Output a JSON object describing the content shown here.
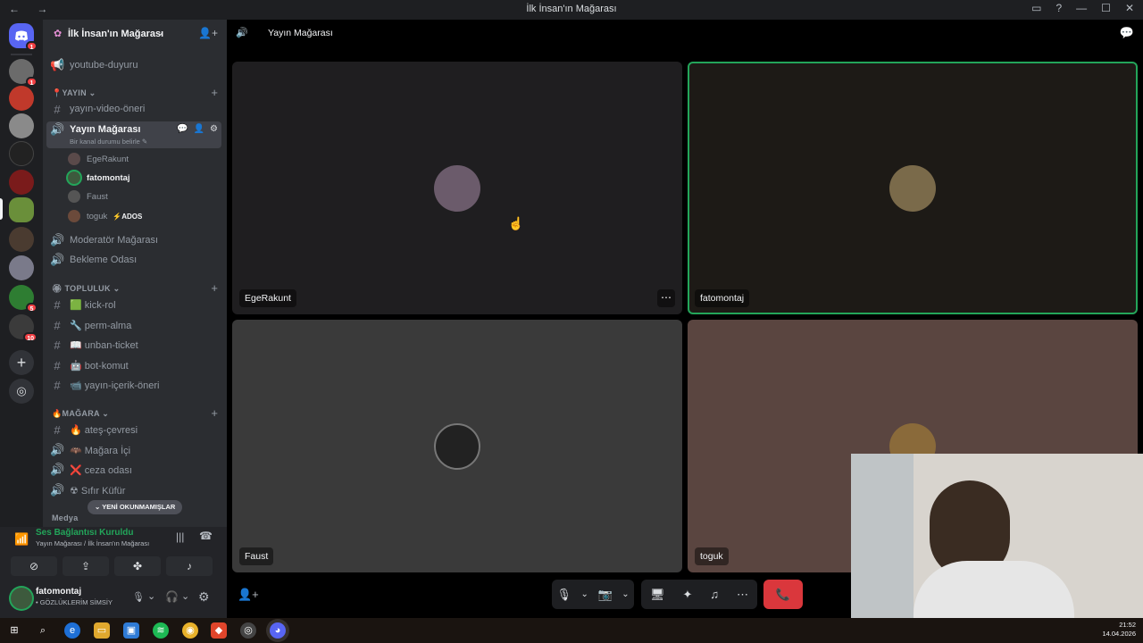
{
  "window": {
    "title": "İlk İnsan'ın Mağarası",
    "nav_arrows": "← →",
    "controls": [
      "▭",
      "?",
      "—",
      "☐",
      "✕"
    ]
  },
  "servers": [
    {
      "name": "direct-messages",
      "badge": "1",
      "color": "#5865f2"
    },
    {
      "name": "server-1",
      "badge": "1",
      "color": "#6b6b6b"
    },
    {
      "name": "server-2",
      "badge": "",
      "color": "#c0392b"
    },
    {
      "name": "server-3",
      "badge": "",
      "color": "#8a8a8a"
    },
    {
      "name": "server-4",
      "badge": "",
      "color": "#222222"
    },
    {
      "name": "server-5",
      "badge": "",
      "color": "#7a1b1b"
    },
    {
      "name": "server-6",
      "badge": "",
      "color": "#6a8f3a"
    },
    {
      "name": "server-7",
      "badge": "",
      "color": "#4a3b30"
    },
    {
      "name": "server-8",
      "badge": "",
      "color": "#7a7a8a"
    },
    {
      "name": "server-9",
      "badge": "5",
      "color": "#2e7d32"
    },
    {
      "name": "server-10",
      "badge": "10",
      "color": "#3b3b3b"
    }
  ],
  "guild": {
    "name": "İlk İnsan'ın Mağarası",
    "chevron": "⌄"
  },
  "channels": {
    "youtube": {
      "icon": "📢",
      "label": "youtube-duyuru"
    },
    "cat_yayin": {
      "label": "YAYIN",
      "prefix": "📍"
    },
    "yayin_video": {
      "label": "yayın-video-öneri"
    },
    "active_voice": {
      "label": "Yayın Mağarası",
      "status": "Bir kanal durumu belirle ✎"
    },
    "voice_users": [
      {
        "name": "EgeRakunt",
        "color": "#5a4a4a"
      },
      {
        "name": "fatomontaj",
        "color": "#3d5a3d",
        "bold": true
      },
      {
        "name": "Faust",
        "color": "#555555"
      },
      {
        "name": "toguk",
        "color": "#6b4a3b",
        "tag": "ADOS"
      }
    ],
    "moderator": {
      "label": "Moderatör Mağarası"
    },
    "bekleme": {
      "label": "Bekleme Odası"
    },
    "cat_topluluk": {
      "label": "TOPLULUK",
      "prefix": "🏵"
    },
    "kick_rol": {
      "label": "🟩 kick-rol"
    },
    "perm_alma": {
      "label": "🔧 perm-alma"
    },
    "unban_ticket": {
      "label": "📖 unban-ticket"
    },
    "bot_komut": {
      "label": "🤖 bot-komut"
    },
    "yayin_icerik": {
      "label": "📹 yayın-içerik-öneri"
    },
    "cat_magara": {
      "label": "MAĞARA",
      "prefix": "🔥"
    },
    "ates": {
      "label": "🔥 ateş-çevresi"
    },
    "magara_ici": {
      "label": "🦇 Mağara İçi"
    },
    "ceza": {
      "label": "❌ ceza odası"
    },
    "sifir": {
      "label": "☢ Sıfır Küfür"
    },
    "cat_medya": {
      "label": "Medya"
    },
    "unread_pill": "⌄ YENİ OKUNMAMIŞLAR"
  },
  "voice_status": {
    "title": "Ses Bağlantısı Kuruldu",
    "subtitle": "Yayın Mağarası / İlk İnsan'ın Mağarası"
  },
  "user": {
    "name": "fatomontaj",
    "status": "• GÖZLÜKLERİM SİMSİY"
  },
  "main": {
    "header_title": "Yayın Mağarası",
    "tiles": [
      {
        "name": "EgeRakunt",
        "bg": "#1f1e20",
        "avatar": "#6b5b6b",
        "speaking": false
      },
      {
        "name": "fatomontaj",
        "bg": "#1d1a16",
        "avatar": "#7a6a4a",
        "speaking": true
      },
      {
        "name": "Faust",
        "bg": "#3a3a3a",
        "avatar": "#222222",
        "speaking": false
      },
      {
        "name": "toguk",
        "bg": "#5a4540",
        "avatar": "#8a6a3a",
        "speaking": false
      }
    ],
    "more_label": "⋯"
  },
  "controls": {
    "mic": "🎙",
    "camera": "📷",
    "screen": "🖥",
    "activities": "✦",
    "soundboard": "♫",
    "more": "⋯",
    "leave": "📞"
  },
  "taskbar": {
    "time": "21:52",
    "date": "14.04.2026"
  },
  "colors": {
    "speaking_green": "#23a55a",
    "leave_red": "#da373c",
    "voice_green": "#23a55a"
  }
}
